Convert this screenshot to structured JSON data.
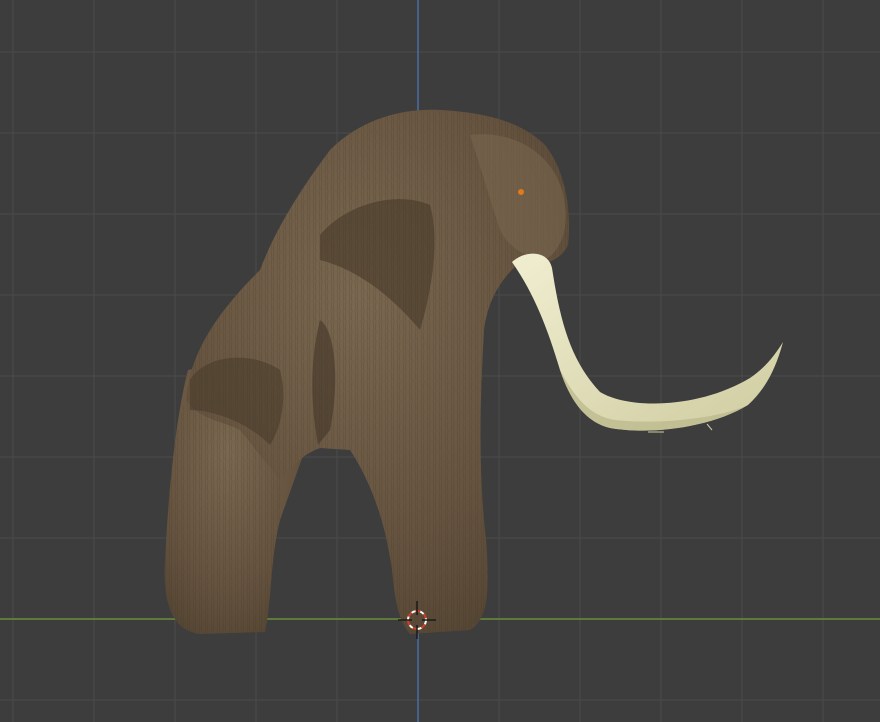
{
  "viewport": {
    "background": "#3d3d3d",
    "grid_color": "#4a4a4a",
    "x_axis_color": "#6a8f3a",
    "z_axis_color": "#4a6fa5",
    "cursor_colors": [
      "#d23b2a",
      "#ffffff"
    ]
  },
  "model": {
    "fur_color": "#6b5a44",
    "fur_dark": "#4a3c2b",
    "fur_light": "#8a7658",
    "tusk_color": "#e8e6c2",
    "eye_color": "#e07a1a"
  }
}
